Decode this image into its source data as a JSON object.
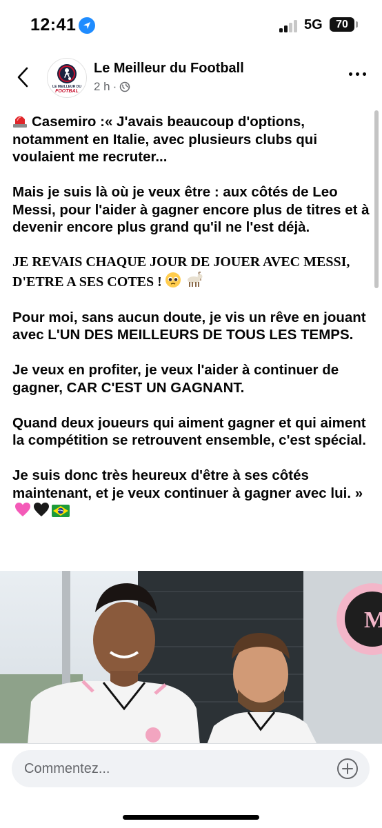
{
  "status_bar": {
    "time": "12:41",
    "network": "5G",
    "battery": "70"
  },
  "header": {
    "page_name": "Le Meilleur du Football",
    "time_ago": "2 h",
    "separator": "·",
    "logo_text_top": "LE MEILLEUR DU",
    "logo_text_bottom": "FOOTBAL"
  },
  "post": {
    "paragraphs": [
      "Casemiro :« J'avais beaucoup d'options, notamment en Italie, avec plusieurs clubs qui voulaient me recruter...",
      "Mais je suis là où je veux être : aux côtés de Leo Messi, pour l'aider à gagner encore plus de titres et à devenir encore plus grand qu'il ne l'est déjà.",
      "JE REVAIS CHAQUE JOUR DE JOUER AVEC MESSI, D'ETRE A SES COTES !",
      "Pour moi, sans aucun doute, je vis un rêve en jouant avec L'UN DES MEILLEURS DE TOUS LES TEMPS.",
      "Je veux en profiter, je veux l'aider à continuer de gagner, CAR C'EST UN GAGNANT.",
      "Quand deux joueurs qui aiment gagner et qui aiment la compétition se retrouvent ensemble, c'est spécial.",
      "Je suis donc très heureux d'être à ses côtés maintenant, et je veux continuer à gagner avec lui. »"
    ]
  },
  "comment": {
    "placeholder": "Commentez..."
  },
  "icons": {
    "siren": "police-light-icon",
    "pleading": "pleading-face-icon",
    "goat": "goat-icon",
    "pink_heart": "pink-heart-icon",
    "black_heart": "black-heart-icon",
    "flag": "brazil-flag-icon"
  },
  "colors": {
    "text": "#050505",
    "secondary_text": "#65676b",
    "input_bg": "#f0f2f5",
    "location_blue": "#1f8cff",
    "logo_red": "#c8102e",
    "logo_navy": "#1a2340"
  }
}
